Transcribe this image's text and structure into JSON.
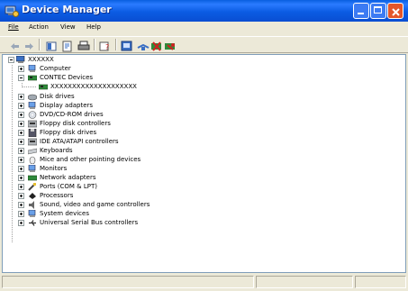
{
  "window": {
    "title": "Device Manager",
    "colors": {
      "title_bar": "#0a5fe0",
      "close_button": "#e4562a",
      "chrome": "#ece9d8"
    }
  },
  "menu": {
    "items": [
      {
        "label": "File"
      },
      {
        "label": "Action"
      },
      {
        "label": "View"
      },
      {
        "label": "Help"
      }
    ]
  },
  "toolbar": {
    "icons": [
      "back-icon",
      "forward-icon",
      "up-icon",
      "properties-icon",
      "print-icon",
      "help-icon",
      "console-icon",
      "scan-icon",
      "uninstall-icon",
      "disable-icon"
    ]
  },
  "tree": {
    "root": "XXXXXX",
    "items": [
      {
        "label": "Computer",
        "icon": "computer-icon",
        "expanded": false
      },
      {
        "label": "CONTEC Devices",
        "icon": "contec-board-icon",
        "expanded": true,
        "children": [
          {
            "label": "XXXXXXXXXXXXXXXXXXXX",
            "icon": "contec-device-icon"
          }
        ]
      },
      {
        "label": "Disk drives",
        "icon": "disk-drive-icon",
        "expanded": false
      },
      {
        "label": "Display adapters",
        "icon": "display-adapter-icon",
        "expanded": false
      },
      {
        "label": "DVD/CD-ROM drives",
        "icon": "dvd-drive-icon",
        "expanded": false
      },
      {
        "label": "Floppy disk controllers",
        "icon": "floppy-controller-icon",
        "expanded": false
      },
      {
        "label": "Floppy disk drives",
        "icon": "floppy-drive-icon",
        "expanded": false
      },
      {
        "label": "IDE ATA/ATAPI controllers",
        "icon": "ide-controller-icon",
        "expanded": false
      },
      {
        "label": "Keyboards",
        "icon": "keyboard-icon",
        "expanded": false
      },
      {
        "label": "Mice and other pointing devices",
        "icon": "mouse-icon",
        "expanded": false
      },
      {
        "label": "Monitors",
        "icon": "monitor-icon",
        "expanded": false
      },
      {
        "label": "Network adapters",
        "icon": "network-adapter-icon",
        "expanded": false
      },
      {
        "label": "Ports (COM & LPT)",
        "icon": "port-icon",
        "expanded": false
      },
      {
        "label": "Processors",
        "icon": "processor-icon",
        "expanded": false
      },
      {
        "label": "Sound, video and game controllers",
        "icon": "sound-icon",
        "expanded": false
      },
      {
        "label": "System devices",
        "icon": "system-device-icon",
        "expanded": false
      },
      {
        "label": "Universal Serial Bus controllers",
        "icon": "usb-icon",
        "expanded": false
      }
    ]
  }
}
